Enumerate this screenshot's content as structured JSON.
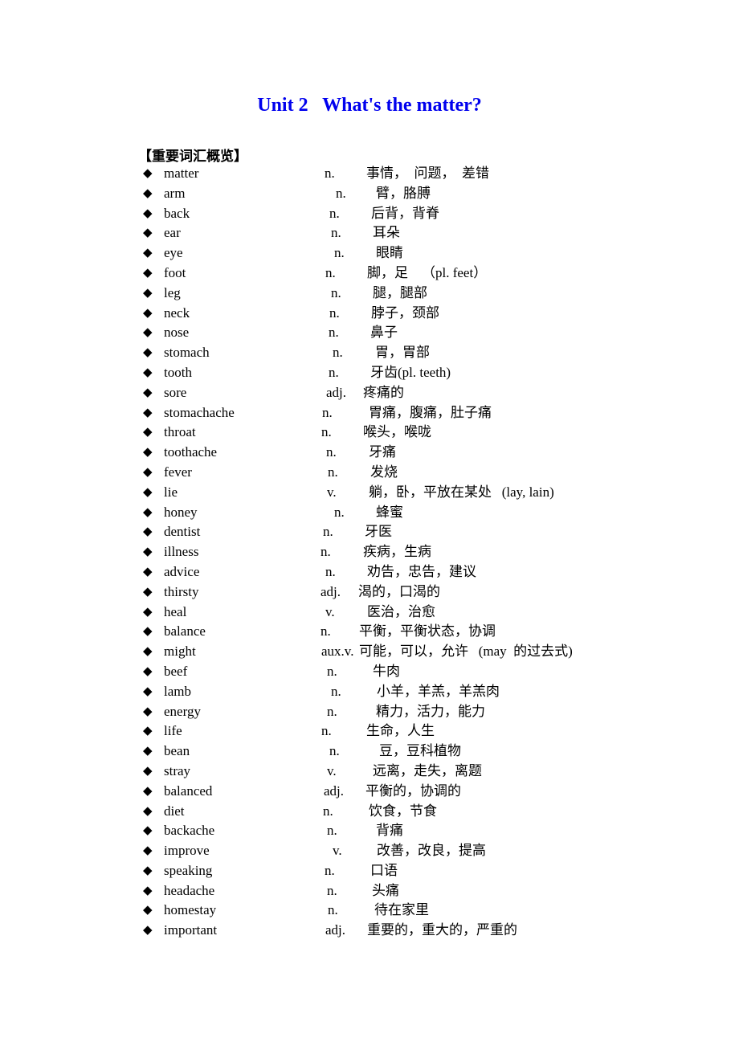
{
  "title": "Unit 2   What's the matter?",
  "section_heading": "【重要词汇概览】",
  "bullet_icon": "◆",
  "vocabulary": [
    {
      "word": "matter",
      "pos": "n.",
      "meaning": "事情，  问题，  差错"
    },
    {
      "word": "arm",
      "pos": "n.",
      "meaning": "臂，胳膊"
    },
    {
      "word": "back",
      "pos": "n.",
      "meaning": "后背，背脊"
    },
    {
      "word": "ear",
      "pos": "n.",
      "meaning": "耳朵"
    },
    {
      "word": "eye",
      "pos": "n.",
      "meaning": "眼睛"
    },
    {
      "word": "foot",
      "pos": "n.",
      "meaning": "脚，足    （pl. feet）"
    },
    {
      "word": "leg",
      "pos": "n.",
      "meaning": "腿，腿部"
    },
    {
      "word": "neck",
      "pos": "n.",
      "meaning": "脖子，颈部"
    },
    {
      "word": "nose",
      "pos": "n.",
      "meaning": "鼻子"
    },
    {
      "word": "stomach",
      "pos": "n.",
      "meaning": "胃，胃部"
    },
    {
      "word": "tooth",
      "pos": "n.",
      "meaning": "牙齿(pl. teeth)"
    },
    {
      "word": "sore",
      "pos": "adj.",
      "meaning": "疼痛的"
    },
    {
      "word": "stomachache",
      "pos": "n.",
      "meaning": "胃痛，腹痛，肚子痛"
    },
    {
      "word": "throat",
      "pos": "n.",
      "meaning": "喉头，喉咙"
    },
    {
      "word": "toothache",
      "pos": "n.",
      "meaning": "牙痛"
    },
    {
      "word": "fever",
      "pos": "n.",
      "meaning": "发烧"
    },
    {
      "word": "lie",
      "pos": "v.",
      "meaning": "躺，卧，平放在某处   (lay, lain)"
    },
    {
      "word": "honey",
      "pos": "n.",
      "meaning": "蜂蜜"
    },
    {
      "word": "dentist",
      "pos": "n.",
      "meaning": "牙医"
    },
    {
      "word": "illness",
      "pos": "n.",
      "meaning": "疾病，生病"
    },
    {
      "word": "advice",
      "pos": "n.",
      "meaning": "劝告，忠告，建议"
    },
    {
      "word": "thirsty",
      "pos": "adj.",
      "meaning": "渴的，口渴的"
    },
    {
      "word": "heal",
      "pos": "v.",
      "meaning": "医治，治愈"
    },
    {
      "word": "balance",
      "pos": "n.",
      "meaning": "平衡，平衡状态，协调"
    },
    {
      "word": "might",
      "pos": "aux.v.",
      "meaning": "可能，可以，允许   (may  的过去式)"
    },
    {
      "word": "beef",
      "pos": "n.",
      "meaning": "牛肉"
    },
    {
      "word": "lamb",
      "pos": "n.",
      "meaning": "小羊，羊羔，羊羔肉"
    },
    {
      "word": "energy",
      "pos": "n.",
      "meaning": "精力，活力，能力"
    },
    {
      "word": "life",
      "pos": "n.",
      "meaning": "生命，人生"
    },
    {
      "word": "bean",
      "pos": "n.",
      "meaning": "豆，豆科植物"
    },
    {
      "word": "stray",
      "pos": "v.",
      "meaning": "远离，走失，离题"
    },
    {
      "word": "balanced",
      "pos": "adj.",
      "meaning": "平衡的，协调的"
    },
    {
      "word": "diet",
      "pos": "n.",
      "meaning": "饮食，节食"
    },
    {
      "word": "backache",
      "pos": "n.",
      "meaning": "背痛"
    },
    {
      "word": "improve",
      "pos": "v.",
      "meaning": "改善，改良，提高"
    },
    {
      "word": "speaking",
      "pos": "n.",
      "meaning": "口语"
    },
    {
      "word": "headache",
      "pos": "n.",
      "meaning": "头痛"
    },
    {
      "word": "homestay",
      "pos": "n.",
      "meaning": "待在家里"
    },
    {
      "word": "important",
      "pos": "adj.",
      "meaning": "重要的，重大的，严重的"
    }
  ]
}
